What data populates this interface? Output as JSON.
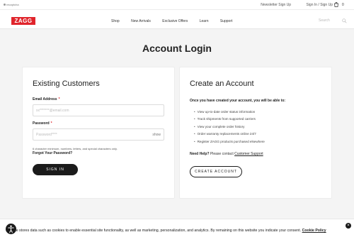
{
  "topbar": {
    "brand_text": "recaptcha",
    "newsletter": "Newsletter Sign Up",
    "signin": "Sign In / Sign Up",
    "cart_count": "0"
  },
  "header": {
    "logo": "ZAGG",
    "nav": [
      "Shop",
      "New Arrivals",
      "Exclusive Offers",
      "Learn",
      "Support"
    ],
    "search_placeholder": "Search"
  },
  "page_title": "Account Login",
  "existing": {
    "heading": "Existing Customers",
    "email_label": "Email Address",
    "email_placeholder": "xx*******@email.com",
    "password_label": "Password",
    "password_placeholder": "Password****",
    "show_label": "show",
    "hint": "6 character minimum, numbers, letters, and special characters only.",
    "forgot": "Forgot Your Password?",
    "signin_button": "SIGN IN"
  },
  "create": {
    "heading": "Create an Account",
    "intro": "Once you have created your account, you will be able to:",
    "benefits": [
      "View up-to-date order status information",
      "Track shipments from supported carriers",
      "View your complete order history",
      "Order warranty replacements online 24/7",
      "Register ZAGG products purchased elsewhere"
    ],
    "help_label": "Need Help?",
    "help_text": "Please contact",
    "help_link": "Customer Support",
    "create_button": "CREATE ACCOUNT"
  },
  "cookie": {
    "text": "website stores data such as cookies to enable essential site functionality, as well as marketing, personalization, and analytics. By remaining on this website you indicate your consent.",
    "policy_link": "Cookie Policy",
    "close_label": "×"
  },
  "colors": {
    "brand_red": "#e0242b",
    "button_dark": "#1b1b1b"
  }
}
